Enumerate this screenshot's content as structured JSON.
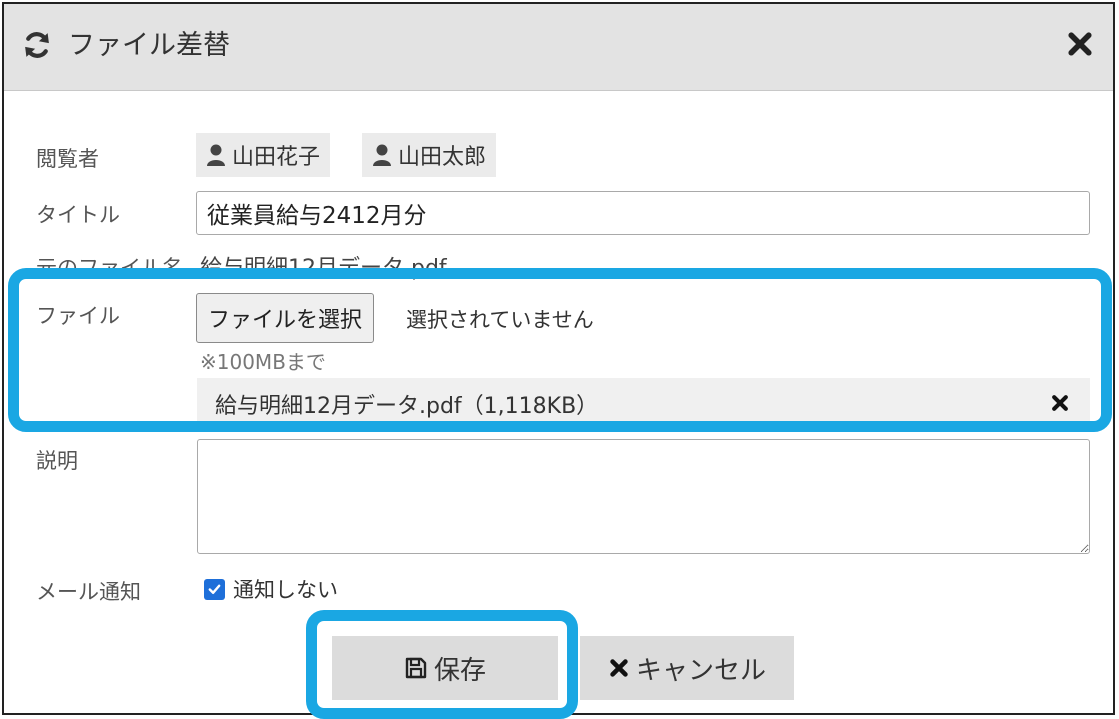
{
  "dialog": {
    "title": "ファイル差替",
    "close_icon": "close-icon",
    "title_icon": "refresh-icon"
  },
  "fields": {
    "viewers_label": "閲覧者",
    "viewers": [
      "山田花子",
      "山田太郎"
    ],
    "title_label": "タイトル",
    "title_value": "従業員給与2412月分",
    "original_name_label": "元のファイル名",
    "original_name_value": "給与明細12月データ.pdf",
    "file_label": "ファイル",
    "file_button": "ファイルを選択",
    "file_status": "選択されていません",
    "size_note": "※100MBまで",
    "selected_file": "給与明細12月データ.pdf（1,118KB）",
    "description_label": "説明",
    "description_value": "",
    "mail_label": "メール通知",
    "mail_checkbox_label": "通知しない",
    "mail_checked": true
  },
  "buttons": {
    "save": "保存",
    "cancel": "キャンセル"
  },
  "colors": {
    "highlight": "#1aa7e3",
    "checkbox": "#1e6fd9",
    "header_bg": "#e3e3e3"
  }
}
